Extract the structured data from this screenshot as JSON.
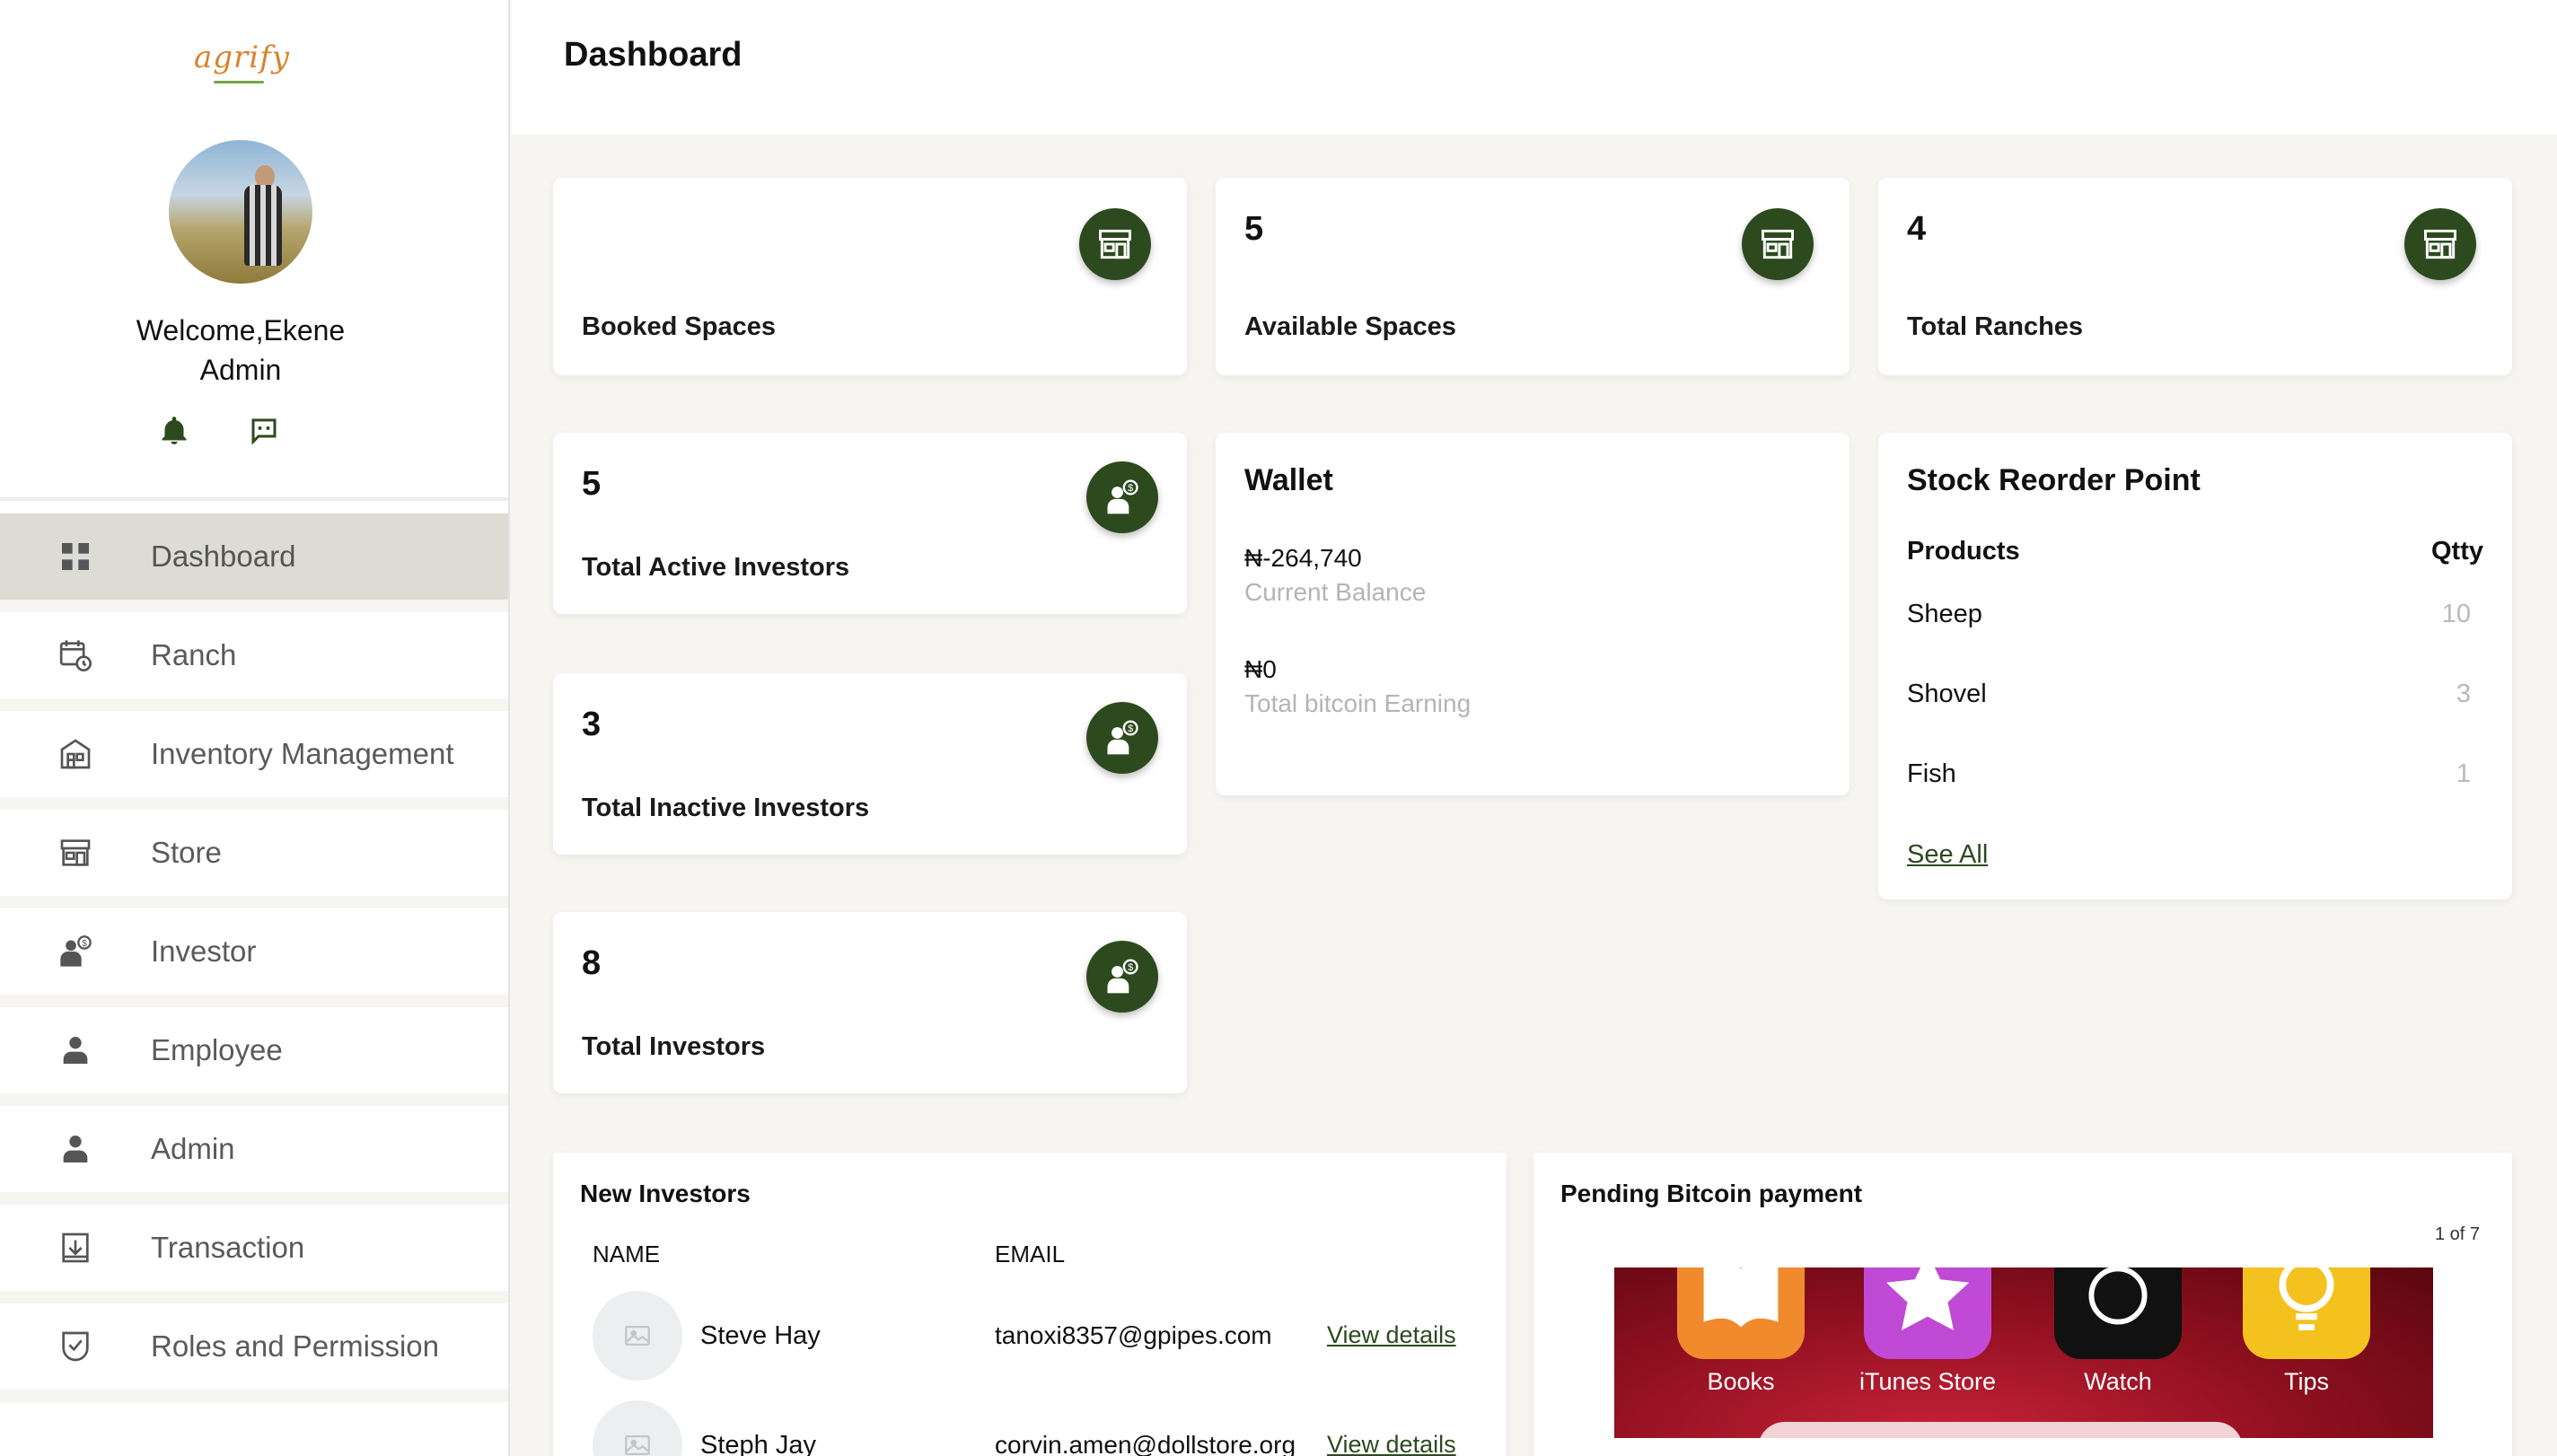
{
  "sidebar": {
    "logo_text": "agrify",
    "welcome": "Welcome,Ekene",
    "role": "Admin",
    "nav": [
      {
        "label": "Dashboard",
        "icon": "grid-icon",
        "active": true
      },
      {
        "label": "Ranch",
        "icon": "calendar-clock-icon"
      },
      {
        "label": "Inventory Management",
        "icon": "warehouse-icon"
      },
      {
        "label": "Store",
        "icon": "store-icon"
      },
      {
        "label": "Investor",
        "icon": "investor-icon"
      },
      {
        "label": "Employee",
        "icon": "person-icon"
      },
      {
        "label": "Admin",
        "icon": "person-icon"
      },
      {
        "label": "Transaction",
        "icon": "download-box-icon"
      },
      {
        "label": "Roles and Permission",
        "icon": "shield-check-icon"
      }
    ]
  },
  "header": {
    "title": "Dashboard"
  },
  "stats": {
    "booked": {
      "value": "",
      "label": "Booked Spaces"
    },
    "available": {
      "value": "5",
      "label": "Available Spaces"
    },
    "ranches": {
      "value": "4",
      "label": "Total Ranches"
    },
    "active_investors": {
      "value": "5",
      "label": "Total Active Investors"
    },
    "inactive_investors": {
      "value": "3",
      "label": "Total Inactive Investors"
    },
    "total_investors": {
      "value": "8",
      "label": "Total Investors"
    }
  },
  "wallet": {
    "title": "Wallet",
    "balance": "₦-264,740",
    "balance_label": "Current Balance",
    "bitcoin": "₦0",
    "bitcoin_label": "Total bitcoin Earning"
  },
  "stock": {
    "title": "Stock Reorder Point",
    "col_products": "Products",
    "col_qty": "Qtty",
    "rows": [
      {
        "product": "Sheep",
        "qty": "10"
      },
      {
        "product": "Shovel",
        "qty": "3"
      },
      {
        "product": "Fish",
        "qty": "1"
      }
    ],
    "see_all": "See All"
  },
  "new_investors": {
    "title": "New Investors",
    "col_name": "NAME",
    "col_email": "EMAIL",
    "rows": [
      {
        "name": "Steve Hay",
        "email": "tanoxi8357@gpipes.com",
        "link": "View details"
      },
      {
        "name": "Steph Jay",
        "email": "corvin.amen@dollstore.org",
        "link": "View details"
      }
    ]
  },
  "pending": {
    "title": "Pending Bitcoin payment",
    "pager": "1 of 7",
    "apps": [
      "Books",
      "iTunes Store",
      "Watch",
      "Tips"
    ]
  },
  "colors": {
    "brand_green": "#2c4a1e",
    "active_nav_bg": "#dcdcd4",
    "logo_orange": "#d9822b"
  }
}
